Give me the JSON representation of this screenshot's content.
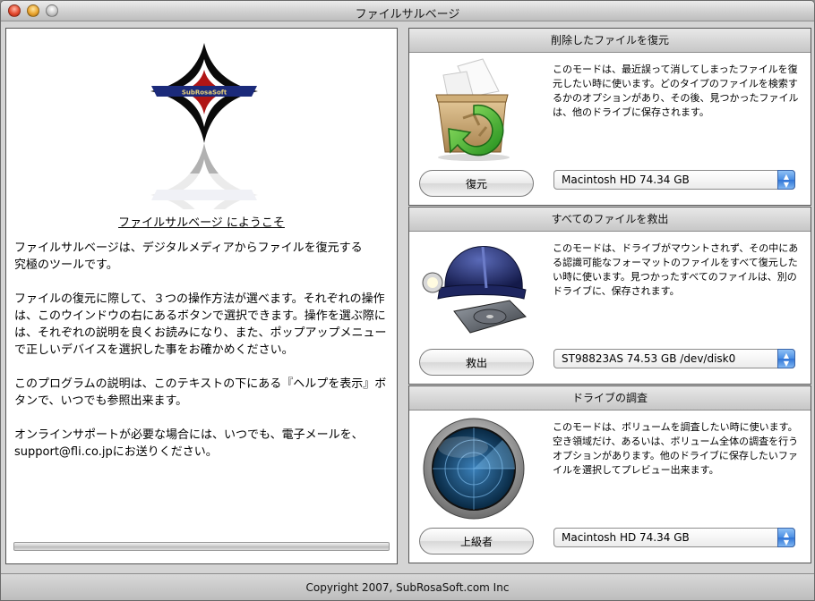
{
  "window": {
    "title": "ファイルサルベージ"
  },
  "logo": {
    "text": "SubRosaSoft"
  },
  "welcome": {
    "title": "ファイルサルベージ にようこそ",
    "paragraphs": [
      "ファイルサルベージは、デジタルメディアからファイルを復元する\n究極のツールです。",
      "ファイルの復元に際して、３つの操作方法が選べます。それぞれの操作\nは、このウインドウの右にあるボタンで選択できます。操作を選ぶ際に\nは、それぞれの説明を良くお読みになり、また、ポップアップメニュー\nで正しいデバイスを選択した事をお確かめください。",
      "このプログラムの説明は、このテキストの下にある『ヘルプを表示』ボ\nタンで、いつでも参照出来ます。",
      "オンラインサポートが必要な場合には、いつでも、電子メールを、\nsupport@fli.co.jpにお送りください。"
    ]
  },
  "progress": {
    "value": 0
  },
  "sections": [
    {
      "header": "削除したファイルを復元",
      "icon": "recycle-box-icon",
      "description": "このモードは、最近誤って消してしまったファイルを復元したい時に使います。どのタイプのファイルを検索するかのオプションがあり、その後、見つかったファイルは、他のドライブに保存されます。",
      "button": "復元",
      "popup": "Macintosh HD 74.34 GB"
    },
    {
      "header": "すべてのファイルを救出",
      "icon": "helmet-disk-icon",
      "description": "このモードは、ドライブがマウントされず、その中にある認識可能なフォーマットのファイルをすべて復元したい時に使います。見つかったすべてのファイルは、別のドライブに、保存されます。",
      "button": "救出",
      "popup": "ST98823AS 74.53 GB /dev/disk0"
    },
    {
      "header": "ドライブの調査",
      "icon": "radar-icon",
      "description": "このモードは、ボリュームを調査したい時に使います。空き領域だけ、あるいは、ボリューム全体の調査を行うオプションがあります。他のドライブに保存したいファイルを選択してプレビュー出来ます。",
      "button": "上級者",
      "popup": "Macintosh HD 74.34 GB"
    }
  ],
  "footer": {
    "copyright": "Copyright 2007, SubRosaSoft.com Inc"
  }
}
